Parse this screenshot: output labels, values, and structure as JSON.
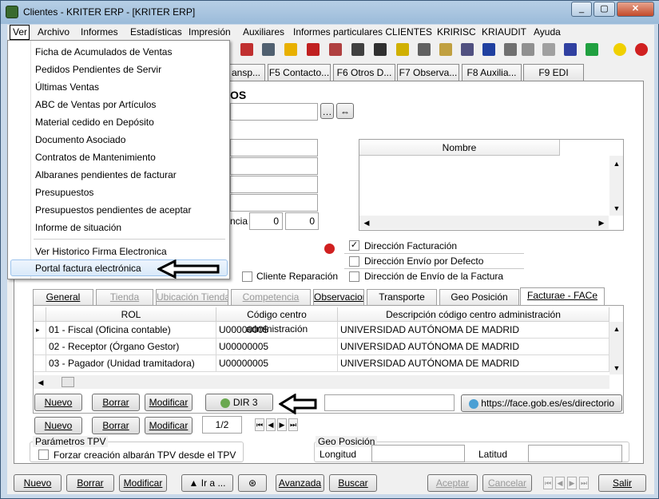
{
  "window": {
    "title": "Clientes - KRITER ERP - [KRITER ERP]"
  },
  "menubar": {
    "items": [
      "Ver",
      "Archivo",
      "Informes",
      "Estadísticas",
      "Impresión",
      "Auxiliares",
      "Informes particulares CLIENTES",
      "KRIRISC",
      "KRIAUDIT",
      "Ayuda"
    ]
  },
  "dropdown": {
    "items": [
      "Ficha de Acumulados de Ventas",
      "Pedidos Pendientes de Servir",
      "Últimas Ventas",
      "ABC de Ventas por Artículos",
      "Material cedido en Depósito",
      "Documento Asociado",
      "Contratos de Mantenimiento",
      "Albaranes pendientes de facturar",
      "Presupuestos",
      "Presupuestos pendientes de aceptar",
      "Informe de situación",
      "Ver Historico Firma Electronica",
      "Portal factura electrónica"
    ]
  },
  "tabs": {
    "top": [
      "ansp...",
      "F5 Contacto...",
      "F6 Otros D...",
      "F7 Observa...",
      "F8 Auxilia...",
      "F9 EDI"
    ]
  },
  "form": {
    "section_title": "OS",
    "ncia_label": "ncia",
    "ncia_val1": "0",
    "ncia_val2": "0",
    "nombre_header": "Nombre",
    "dir_facturacion": "Dirección Facturación",
    "dir_envio_defecto": "Dirección Envío por Defecto",
    "dir_envio_factura": "Dirección de Envío de la Factura",
    "cliente_reparacion": "Cliente Reparación"
  },
  "inner_tabs": [
    "General",
    "Tienda",
    "Ubicación Tienda",
    "Competencia",
    "Observacione",
    "Transporte",
    "Geo Posición",
    "Facturae - FACe"
  ],
  "grid": {
    "headers": [
      "ROL",
      "Código centro administración",
      "Descripción código centro administración"
    ],
    "rows": [
      {
        "rol": "01 - Fiscal (Oficina contable)",
        "codigo": "U00000005",
        "desc": "UNIVERSIDAD AUTÓNOMA DE MADRID"
      },
      {
        "rol": "02 - Receptor (Órgano Gestor)",
        "codigo": "U00000005",
        "desc": "UNIVERSIDAD AUTÓNOMA DE MADRID"
      },
      {
        "rol": "03 - Pagador (Unidad tramitadora)",
        "codigo": "U00000005",
        "desc": "UNIVERSIDAD AUTÓNOMA DE MADRID"
      }
    ]
  },
  "buttons": {
    "nuevo": "Nuevo",
    "borrar": "Borrar",
    "modificar": "Modificar",
    "dir3": "DIR 3",
    "face_link": "https://face.gob.es/es/directorio",
    "page": "1/2",
    "ir_a": "Ir a ...",
    "avanzada": "Avanzada",
    "buscar": "Buscar",
    "aceptar": "Aceptar",
    "cancelar": "Cancelar",
    "salir": "Salir"
  },
  "tpv": {
    "group": "Parámetros TPV",
    "forzar": "Forzar creación albarán TPV desde el TPV"
  },
  "geo": {
    "group": "Geo Posición",
    "longitud": "Longitud",
    "latitud": "Latitud"
  }
}
